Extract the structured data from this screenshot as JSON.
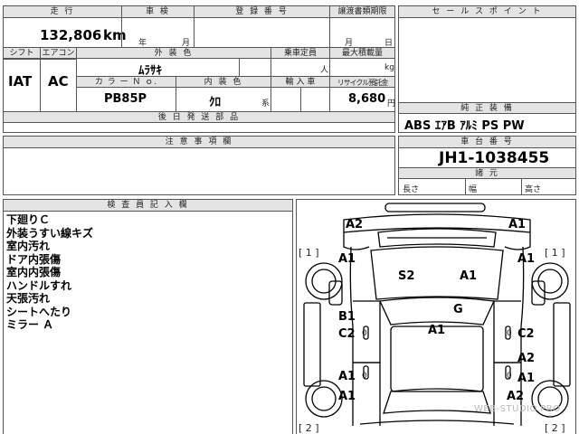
{
  "top": {
    "mileage_label": "走 行",
    "inspection_label": "車 検",
    "registration_label": "登 録 番 号",
    "transfer_label": "譲渡書類期限",
    "mileage_value": "132,806",
    "mileage_unit": "km",
    "insp_year": "年",
    "insp_month": "月",
    "transfer_month": "月",
    "transfer_day": "日",
    "shift_label": "シフト",
    "ac_label": "エアコン",
    "exterior_label": "外 装 色",
    "capacity_label": "乗車定員",
    "max_load_label": "最大積載量",
    "shift_value": "IAT",
    "ac_value": "AC",
    "exterior_value": "ﾑﾗｻｷ",
    "capacity_unit": "人",
    "load_unit": "kg",
    "color_no_label": "カ ラ ー Ｎ ｏ.",
    "interior_label": "内 装 色",
    "import_label": "輸 入 車",
    "recycle_label": "リサイクル預託金",
    "color_no_value": "PB85P",
    "interior_value": "ｸﾛ",
    "interior_suffix": "系",
    "recycle_value": "8,680",
    "recycle_unit": "円",
    "later_parts_label": "後 日 発 送 部 品",
    "notes_label": "注 意 事 項 欄",
    "inspector_label": "検 査 員 記 入 欄"
  },
  "sales": {
    "title": "セ ー ル ス ポ イ ン ト",
    "equipment_label": "純 正 装 備",
    "equipment_value": "ABS ｴｱB ｱﾙﾐ PS PW",
    "chassis_label": "車 台 番 号",
    "chassis_value": "JH1-1038455",
    "dims_label": "諸 元",
    "length_label": "長さ",
    "width_label": "幅",
    "height_label": "高さ"
  },
  "inspector_notes": [
    "下廻りＣ",
    "外装うすい線キズ",
    "室内汚れ",
    "ドア内張傷",
    "室内内張傷",
    "ハンドルすれ",
    "天張汚れ",
    "シートへたり",
    "ミラー Ａ"
  ],
  "diagram": {
    "bracket_1_left": "[ 1 ]",
    "bracket_1_right": "[ 1 ]",
    "bracket_2_left": "[ 2 ]",
    "bracket_2_right": "[ 2 ]",
    "marks": [
      {
        "id": "front-left-corner",
        "code": "A2"
      },
      {
        "id": "front-right-corner",
        "code": "A1"
      },
      {
        "id": "front-left-fender",
        "code": "A1"
      },
      {
        "id": "front-right-fender",
        "code": "A1"
      },
      {
        "id": "hood-left",
        "code": "S2"
      },
      {
        "id": "hood-right",
        "code": "A1"
      },
      {
        "id": "windshield",
        "code": "G"
      },
      {
        "id": "left-front-door-top",
        "code": "B1"
      },
      {
        "id": "left-front-door",
        "code": "C2"
      },
      {
        "id": "roof",
        "code": "A1"
      },
      {
        "id": "right-front-door",
        "code": "C2"
      },
      {
        "id": "right-rear-door",
        "code": "A2"
      },
      {
        "id": "left-rear-door",
        "code": "A1"
      },
      {
        "id": "right-rear-fender",
        "code": "A1"
      },
      {
        "id": "left-rear-fender",
        "code": "A1"
      },
      {
        "id": "right-rear-corner",
        "code": "A2"
      }
    ],
    "zero_marks": [
      "0",
      "0",
      "0",
      "0"
    ],
    "watermark": "WEB-STUDIO.PRO"
  }
}
